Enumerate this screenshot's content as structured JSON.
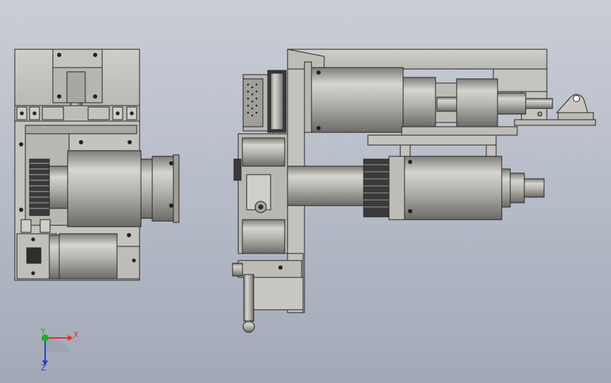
{
  "viewport": {
    "background_top": "#c9cdd6",
    "background_bottom": "#a2a9b6",
    "part_color": "#c8c7c1",
    "part_shade": "#8f8e88",
    "edge_color": "#222222"
  },
  "triad": {
    "x_label": "X",
    "y_label": "Y",
    "z_label": "Z",
    "x_color": "#e03030",
    "y_color": "#20b020",
    "z_color": "#2040d0"
  }
}
